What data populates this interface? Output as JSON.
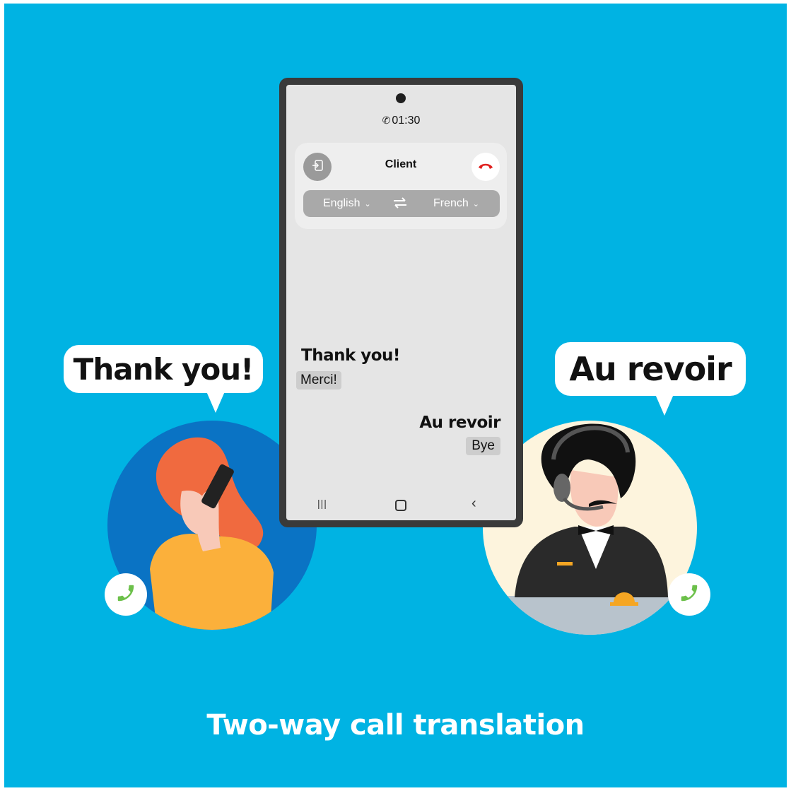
{
  "phone": {
    "call_timer": "01:30",
    "contact_name": "Client",
    "source_language": "English",
    "target_language": "French",
    "conversation": [
      {
        "text": "Thank you!",
        "translation": "Merci!"
      },
      {
        "text": "Au revoir",
        "translation": "Bye"
      }
    ]
  },
  "bubbles": {
    "left": "Thank you!",
    "right": "Au revoir"
  },
  "caption": "Two-way call translation",
  "colors": {
    "background": "#00b3e3",
    "end_call": "#e0201e",
    "call_badge": "#6cc04a"
  }
}
